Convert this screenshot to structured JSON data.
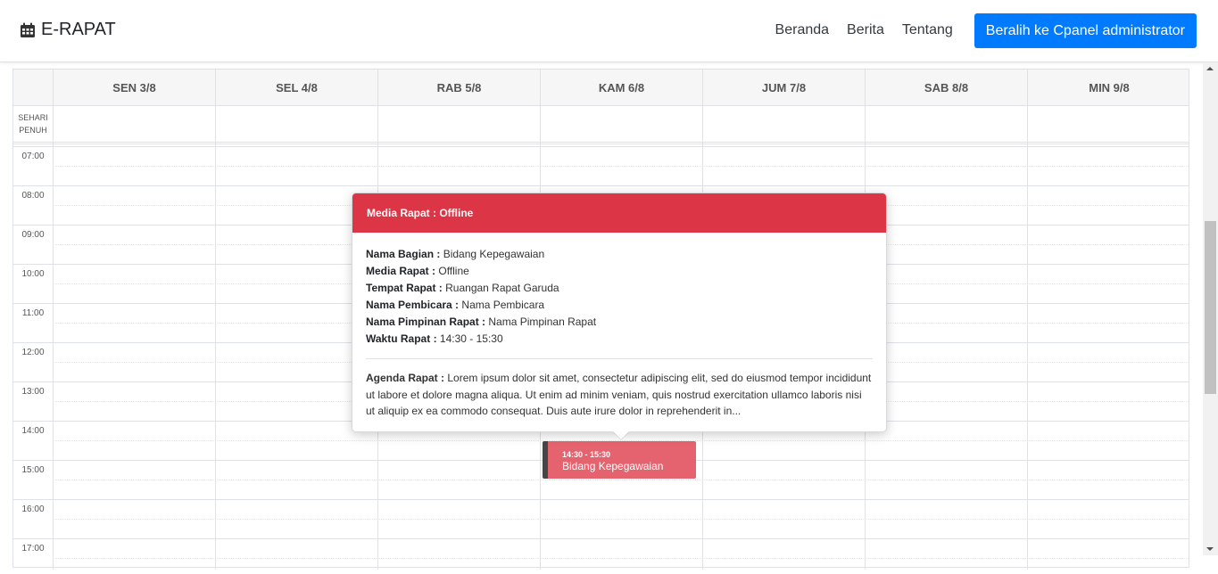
{
  "navbar": {
    "brand": "E-RAPAT",
    "links": [
      "Beranda",
      "Berita",
      "Tentang"
    ],
    "admin_button": "Beralih ke Cpanel administrator"
  },
  "calendar": {
    "days": [
      "SEN 3/8",
      "SEL 4/8",
      "RAB 5/8",
      "KAM 6/8",
      "JUM 7/8",
      "SAB 8/8",
      "MIN 9/8"
    ],
    "allday_label": "SEHARI PENUH",
    "times": [
      "07:00",
      "08:00",
      "09:00",
      "10:00",
      "11:00",
      "12:00",
      "13:00",
      "14:00",
      "15:00",
      "16:00",
      "17:00"
    ]
  },
  "event": {
    "time": "14:30 - 15:30",
    "title": "Bidang Kepegawaian",
    "color": "#e5636f"
  },
  "popover": {
    "title": "Media Rapat : Offline",
    "header_color": "#dc3545",
    "fields": [
      {
        "label": "Nama Bagian :",
        "value": "Bidang Kepegawaian"
      },
      {
        "label": "Media Rapat :",
        "value": "Offline"
      },
      {
        "label": "Tempat Rapat :",
        "value": "Ruangan Rapat Garuda"
      },
      {
        "label": "Nama Pembicara :",
        "value": "Nama Pembicara"
      },
      {
        "label": "Nama Pimpinan Rapat :",
        "value": "Nama Pimpinan Rapat"
      },
      {
        "label": "Waktu Rapat :",
        "value": "14:30 - 15:30"
      }
    ],
    "agenda_label": "Agenda Rapat :",
    "agenda_text": "Lorem ipsum dolor sit amet, consectetur adipiscing elit, sed do eiusmod tempor incididunt ut labore et dolore magna aliqua. Ut enim ad minim veniam, quis nostrud exercitation ullamco laboris nisi ut aliquip ex ea commodo consequat. Duis aute irure dolor in reprehenderit in..."
  },
  "icons": {
    "brand_icon": "calendar-icon"
  }
}
